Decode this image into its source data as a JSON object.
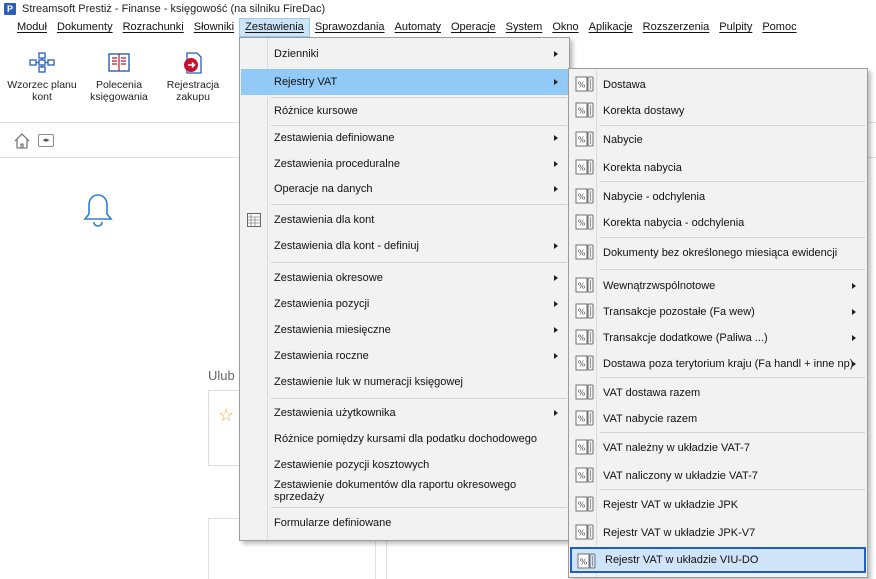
{
  "window": {
    "title": "Streamsoft Prestiż - Finanse - księgowość (na silniku FireDac)",
    "logo": "P"
  },
  "menubar": [
    {
      "label": "Moduł"
    },
    {
      "label": "Dokumenty"
    },
    {
      "label": "Rozrachunki"
    },
    {
      "label": "Słowniki"
    },
    {
      "label": "Zestawienia",
      "active": true
    },
    {
      "label": "Sprawozdania"
    },
    {
      "label": "Automaty"
    },
    {
      "label": "Operacje"
    },
    {
      "label": "System"
    },
    {
      "label": "Okno"
    },
    {
      "label": "Aplikacje"
    },
    {
      "label": "Rozszerzenia"
    },
    {
      "label": "Pulpity"
    },
    {
      "label": "Pomoc"
    }
  ],
  "ribbon": [
    {
      "line1": "Wzorzec planu",
      "line2": "kont",
      "icon": "org-chart-icon"
    },
    {
      "line1": "Polecenia",
      "line2": "księgowania",
      "icon": "ledger-icon"
    },
    {
      "line1": "Rejestracja",
      "line2": "zakupu",
      "icon": "purchase-icon"
    }
  ],
  "home": {
    "favorites_label": "Ulub"
  },
  "zestawienia_menu": [
    {
      "label": "Dzienniki",
      "submenu": true
    },
    {
      "label": "Rejestry VAT",
      "submenu": true,
      "highlighted": true
    },
    {
      "label": "Różnice kursowe"
    },
    {
      "label": "Zestawienia definiowane",
      "submenu": true
    },
    {
      "label": "Zestawienia proceduralne",
      "submenu": true
    },
    {
      "label": "Operacje na danych",
      "submenu": true
    },
    {
      "label": "Zestawienia dla kont",
      "icon": "table-icon"
    },
    {
      "label": "Zestawienia dla kont - definiuj",
      "submenu": true
    },
    {
      "label": "Zestawienia okresowe",
      "submenu": true
    },
    {
      "label": "Zestawienia pozycji",
      "submenu": true
    },
    {
      "label": "Zestawienia miesięczne",
      "submenu": true
    },
    {
      "label": "Zestawienia roczne",
      "submenu": true
    },
    {
      "label": "Zestawienie luk w numeracji księgowej"
    },
    {
      "label": "Zestawienia użytkownika",
      "submenu": true
    },
    {
      "label": "Różnice pomiędzy kursami dla podatku dochodowego"
    },
    {
      "label": "Zestawienie pozycji kosztowych"
    },
    {
      "label": "Zestawienie dokumentów dla raportu okresowego sprzedaży"
    },
    {
      "label": "Formularze definiowane"
    }
  ],
  "rejestry_menu": [
    {
      "label": "Dostawa"
    },
    {
      "label": "Korekta dostawy"
    },
    {
      "label": "Nabycie"
    },
    {
      "label": "Korekta nabycia"
    },
    {
      "label": "Nabycie - odchylenia"
    },
    {
      "label": "Korekta nabycia - odchylenia"
    },
    {
      "label": "Dokumenty bez określonego miesiąca ewidencji"
    },
    {
      "label": "Wewnątrzwspólnotowe",
      "submenu": true
    },
    {
      "label": "Transakcje pozostałe (Fa wew)",
      "submenu": true
    },
    {
      "label": "Transakcje dodatkowe (Paliwa ...)",
      "submenu": true
    },
    {
      "label": "Dostawa poza terytorium kraju (Fa handl + inne np)",
      "submenu": true
    },
    {
      "label": "VAT dostawa razem"
    },
    {
      "label": "VAT nabycie razem"
    },
    {
      "label": "VAT należny w układzie VAT-7"
    },
    {
      "label": "VAT naliczony w układzie VAT-7"
    },
    {
      "label": "Rejestr VAT w układzie JPK"
    },
    {
      "label": "Rejestr VAT w układzie JPK-V7"
    },
    {
      "label": "Rejestr VAT w układzie VIU-DO",
      "selected": true
    }
  ],
  "colors": {
    "highlight": "#91c9f7",
    "selected_border": "#1f5fc4",
    "accent": "#2b5fb8",
    "icon_red": "#c8102e"
  }
}
